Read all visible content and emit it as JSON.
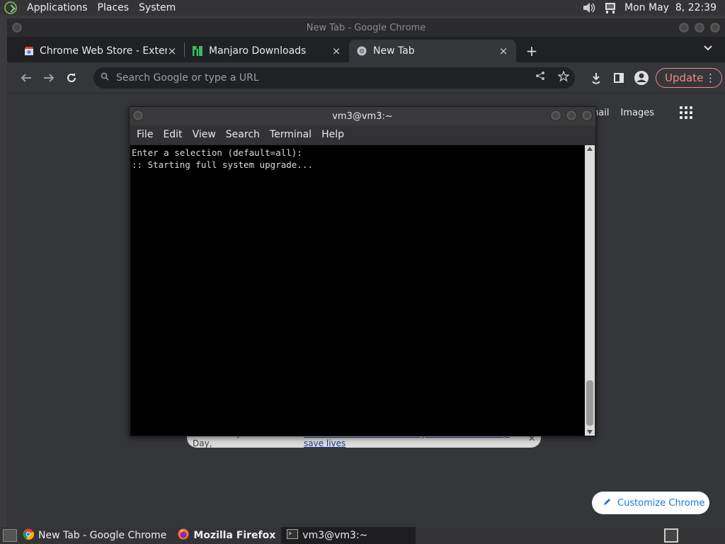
{
  "top_panel": {
    "menus": [
      "Applications",
      "Places",
      "System"
    ],
    "clock": "Mon May  8, 22:39"
  },
  "chrome": {
    "title": "New Tab - Google Chrome",
    "tabs": [
      {
        "label": "Chrome Web Store - Extensio",
        "close": "×"
      },
      {
        "label": "Manjaro Downloads",
        "close": "×"
      },
      {
        "label": "New Tab",
        "close": "×"
      }
    ],
    "new_tab": "+",
    "omnibox_placeholder": "Search Google or type a URL",
    "update_label": "Update",
    "ntp": {
      "gmail": "Gmail",
      "images": "Images",
      "notice_text": "On Fentanyl Awareness Day,",
      "notice_link": "learn about the hidden dangers and how to help save lives",
      "customize_label": "Customize Chrome"
    }
  },
  "terminal": {
    "title": "vm3@vm3:~",
    "menus": [
      "File",
      "Edit",
      "View",
      "Search",
      "Terminal",
      "Help"
    ],
    "lines": [
      "Enter a selection (default=all):",
      ":: Starting full system upgrade..."
    ]
  },
  "taskbar": {
    "items": [
      {
        "label": "New Tab - Google Chrome"
      },
      {
        "label": "Mozilla Firefox"
      },
      {
        "label": "vm3@vm3:~"
      }
    ]
  },
  "colors": {
    "accent_update": "#f28b82",
    "link_blue": "#1a73e8"
  }
}
